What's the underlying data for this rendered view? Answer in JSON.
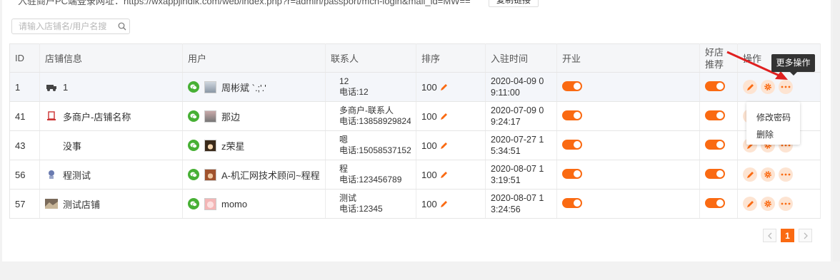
{
  "top": {
    "url_text": "入驻商户PC端登录网址：https://wxappjindik.com/web/index.php?r=admin/passport/mch-login&mall_id=MW==",
    "copy_label": "复制链接"
  },
  "search": {
    "placeholder": "请输入店铺名/用户名搜"
  },
  "table": {
    "headers": {
      "id": "ID",
      "shop": "店铺信息",
      "user": "用户",
      "contact": "联系人",
      "sort": "排序",
      "time": "入驻时间",
      "open": "开业",
      "rec": "好店推荐",
      "ops": "操作"
    },
    "rows": [
      {
        "id": "1",
        "shop": "1",
        "user": "周彬斌 `.;'.'",
        "contact_name": "12",
        "contact_phone": "电话:12",
        "sort": "100",
        "time": "2020-04-09 09:11:00",
        "open": true,
        "rec": true
      },
      {
        "id": "41",
        "shop": "多商户-店铺名称",
        "user": "那边",
        "contact_name": "多商户-联系人",
        "contact_phone": "电话:13858929824-",
        "sort": "100",
        "time": "2020-07-09 09:24:17",
        "open": true,
        "rec": true
      },
      {
        "id": "43",
        "shop": "没事",
        "user": "z荣星",
        "contact_name": "嗯",
        "contact_phone": "电话:15058537152",
        "sort": "100",
        "time": "2020-07-27 15:34:51",
        "open": true,
        "rec": true
      },
      {
        "id": "56",
        "shop": "程测试",
        "user": "A-机汇网技术顾问~程程",
        "contact_name": "程",
        "contact_phone": "电话:123456789",
        "sort": "100",
        "time": "2020-08-07 13:19:51",
        "open": true,
        "rec": true
      },
      {
        "id": "57",
        "shop": "测试店铺",
        "user": "momo",
        "contact_name": "测试",
        "contact_phone": "电话:12345",
        "sort": "100",
        "time": "2020-08-07 13:24:56",
        "open": true,
        "rec": true
      }
    ]
  },
  "tooltip": "更多操作",
  "menu": {
    "items": [
      "修改密码",
      "删除"
    ]
  },
  "pagination": {
    "current": "1"
  },
  "colors": {
    "accent": "#fa6a12",
    "wechat": "#47b035"
  }
}
